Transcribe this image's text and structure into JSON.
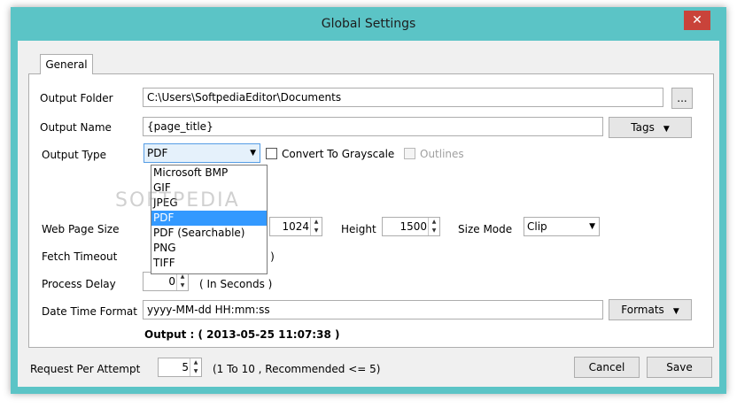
{
  "window": {
    "title": "Global Settings",
    "close_glyph": "✕"
  },
  "tab": {
    "general": "General"
  },
  "output_folder": {
    "label": "Output Folder",
    "value": "C:\\Users\\SoftpediaEditor\\Documents",
    "browse": "..."
  },
  "output_name": {
    "label": "Output Name",
    "value": "{page_title}",
    "tags_button": "Tags"
  },
  "output_type": {
    "label": "Output Type",
    "selected": "PDF",
    "options": [
      "Microsoft BMP",
      "GIF",
      "JPEG",
      "PDF",
      "PDF (Searchable)",
      "PNG",
      "TIFF"
    ],
    "convert_grayscale": "Convert To Grayscale",
    "outlines": "Outlines"
  },
  "web_page_size": {
    "label": "Web Page Size",
    "width": "1024",
    "height_label": "Height",
    "height": "1500",
    "size_mode_label": "Size Mode",
    "size_mode": "Clip"
  },
  "fetch_timeout": {
    "label": "Fetch Timeout",
    "unit_tail": "s )"
  },
  "process_delay": {
    "label": "Process Delay",
    "value": "0",
    "unit": "( In Seconds )"
  },
  "date_time_format": {
    "label": "Date Time Format",
    "value": "yyyy-MM-dd HH:mm:ss",
    "formats_button": "Formats"
  },
  "output_preview": "Output : ( 2013-05-25 11:07:38 )",
  "request_per_attempt": {
    "label": "Request Per Attempt",
    "value": "5",
    "hint": "(1 To 10 , Recommended <= 5)"
  },
  "buttons": {
    "cancel": "Cancel",
    "save": "Save"
  },
  "watermark": "SOFTPEDIA",
  "icons": {
    "dropdown": "chevron-down-icon",
    "spin_up": "arrow-up-icon",
    "spin_down": "arrow-down-icon"
  },
  "colors": {
    "titlebar": "#5bc4c6",
    "close": "#c9433a",
    "selection": "#3399ff"
  }
}
